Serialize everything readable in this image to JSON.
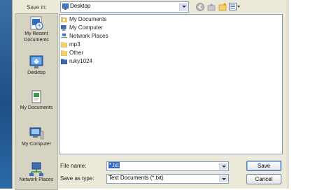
{
  "dialog": {
    "save_in_label": "Save in:",
    "save_in_value": "Desktop",
    "file_name_label": "File name:",
    "file_name_value": "*.txt",
    "save_as_type_label": "Save as type:",
    "save_as_type_value": "Text Documents (*.txt)",
    "save_button": "Save",
    "cancel_button": "Cancel"
  },
  "places": [
    {
      "label": "My Recent Documents",
      "icon": "recent-documents-icon"
    },
    {
      "label": "Desktop",
      "icon": "desktop-icon"
    },
    {
      "label": "My Documents",
      "icon": "my-documents-icon"
    },
    {
      "label": "My Computer",
      "icon": "my-computer-icon"
    },
    {
      "label": "Network Places",
      "icon": "network-places-icon"
    }
  ],
  "files": [
    {
      "name": "My Documents",
      "icon": "documents-folder-icon"
    },
    {
      "name": "My Computer",
      "icon": "computer-icon"
    },
    {
      "name": "Network Places",
      "icon": "network-icon"
    },
    {
      "name": "mp3",
      "icon": "folder-icon"
    },
    {
      "name": "Other",
      "icon": "folder-icon"
    },
    {
      "name": "ruky1024",
      "icon": "user-folder-icon"
    }
  ],
  "toolbar_icons": [
    "back-icon",
    "up-folder-icon",
    "new-folder-icon",
    "views-menu-icon"
  ]
}
